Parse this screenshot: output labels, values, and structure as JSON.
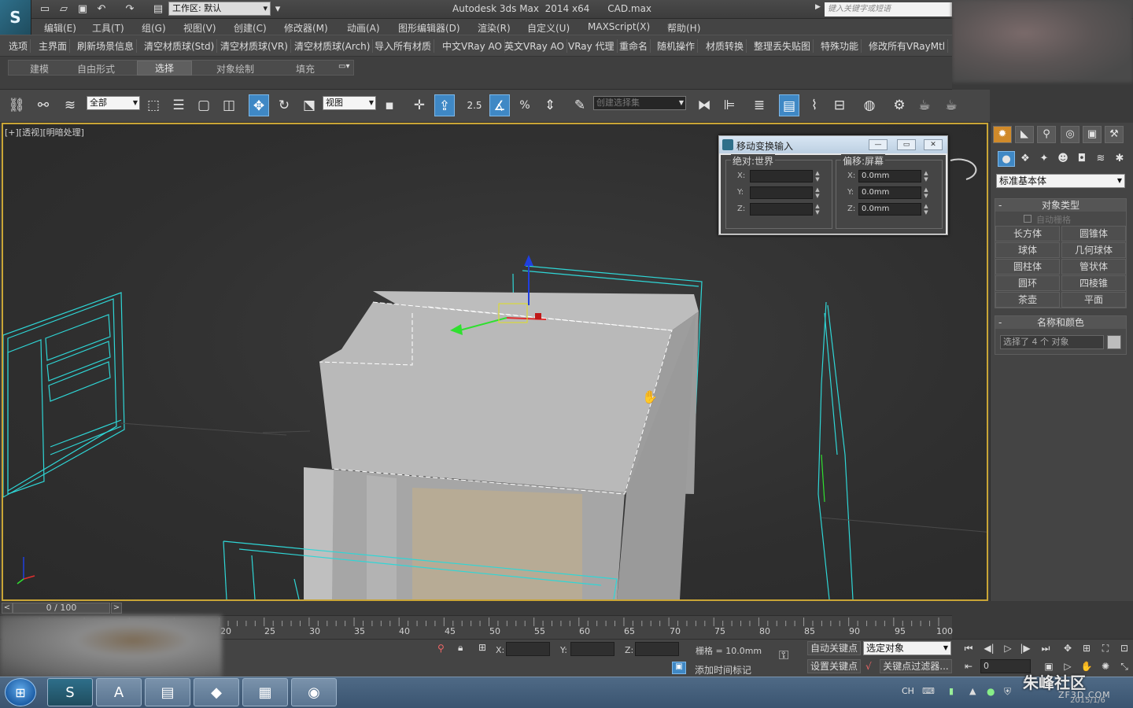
{
  "titlebar": {
    "workspace": "工作区: 默认",
    "title": "Autodesk 3ds Max  2014 x64      CAD.max",
    "search_placeholder": "键入关键字或短语"
  },
  "menu": [
    "编辑(E)",
    "工具(T)",
    "组(G)",
    "视图(V)",
    "创建(C)",
    "修改器(M)",
    "动画(A)",
    "图形编辑器(D)",
    "渲染(R)",
    "自定义(U)",
    "MAXScript(X)",
    "帮助(H)"
  ],
  "custom_toolbar": [
    "选项",
    "主界面",
    "刷新场景信息",
    "清空材质球(Std)",
    "清空材质球(VR)",
    "清空材质球(Arch)",
    "导入所有材质",
    "中文VRay AO",
    "英文VRay AO",
    "VRay 代理",
    "重命名",
    "随机操作",
    "材质转换",
    "整理丢失贴图",
    "特殊功能",
    "修改所有VRayMtl"
  ],
  "ribbon_tabs": [
    "建模",
    "自由形式",
    "选择",
    "对象绘制",
    "填充"
  ],
  "ribbon_active": "选择",
  "main_toolbar": {
    "filter": "全部",
    "ref_coord": "视图",
    "snap_angle": "2.5",
    "selection_set": "创建选择集"
  },
  "viewport": {
    "label": "[+][透视][明暗处理]"
  },
  "dialog": {
    "title": "移动变换输入",
    "group_left": "绝对:世界",
    "group_right": "偏移:屏幕",
    "axes": [
      "X:",
      "Y:",
      "Z:"
    ],
    "offset_values": [
      "0.0mm",
      "0.0mm",
      "0.0mm"
    ]
  },
  "command_panel": {
    "category": "标准基本体",
    "object_type_header": "对象类型",
    "autogrid": "自动栅格",
    "primitives": [
      "长方体",
      "圆锥体",
      "球体",
      "几何球体",
      "圆柱体",
      "管状体",
      "圆环",
      "四棱锥",
      "茶壶",
      "平面"
    ],
    "name_color_header": "名称和颜色",
    "selection_text": "选择了 4 个 对象"
  },
  "timeline": {
    "position": "0 / 100",
    "ticks": [
      "20",
      "25",
      "30",
      "35",
      "40",
      "45",
      "50",
      "55",
      "60",
      "65",
      "70",
      "75",
      "80",
      "85",
      "90",
      "95",
      "100"
    ]
  },
  "status": {
    "x_label": "X:",
    "y_label": "Y:",
    "z_label": "Z:",
    "grid": "栅格 = 10.0mm",
    "add_time_tag": "添加时间标记",
    "auto_key": "自动关键点",
    "set_key": "设置关键点",
    "selected_object": "选定对象",
    "key_filters": "关键点过滤器...",
    "frame": "0"
  },
  "taskbar": {
    "lang": "CH",
    "watermark": "朱峰社区",
    "watermark_sub": "ZF3D.COM",
    "date": "2015/1/6"
  }
}
